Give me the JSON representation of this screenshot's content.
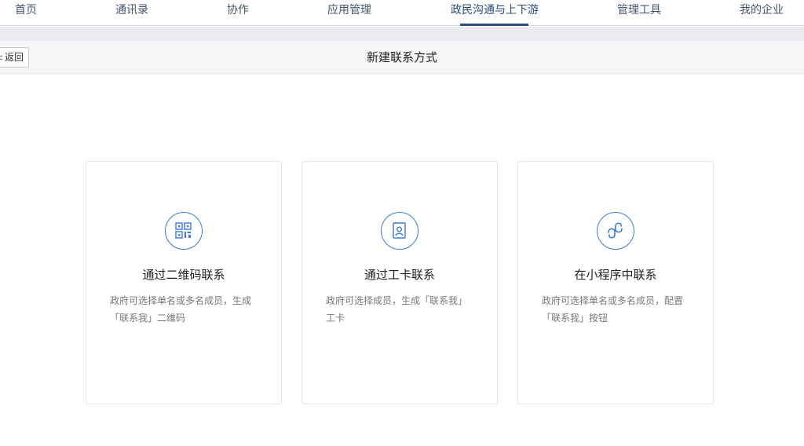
{
  "nav": {
    "items": [
      {
        "label": "首页"
      },
      {
        "label": "通讯录"
      },
      {
        "label": "协作"
      },
      {
        "label": "应用管理"
      },
      {
        "label": "政民沟通与上下游"
      },
      {
        "label": "管理工具"
      },
      {
        "label": "我的企业"
      }
    ],
    "active_index": 4
  },
  "header": {
    "back_label": "返回",
    "back_icon": "chevron-left-icon",
    "title": "新建联系方式"
  },
  "cards": [
    {
      "icon": "qr-code-icon",
      "title": "通过二维码联系",
      "desc_line1": "政府可选择单名或多名成员，生成",
      "desc_line2": "「联系我」二维码"
    },
    {
      "icon": "work-card-icon",
      "title": "通过工卡联系",
      "desc_line1": "政府可选择成员，生成「联系我」",
      "desc_line2": "工卡"
    },
    {
      "icon": "mini-program-icon",
      "title": "在小程序中联系",
      "desc_line1": "政府可选择单名或多名成员，配置",
      "desc_line2": "「联系我」按钮"
    }
  ],
  "colors": {
    "accent": "#3b7bd1",
    "nav_active_underline": "#2f4f80",
    "nav_text": "#44556d"
  }
}
